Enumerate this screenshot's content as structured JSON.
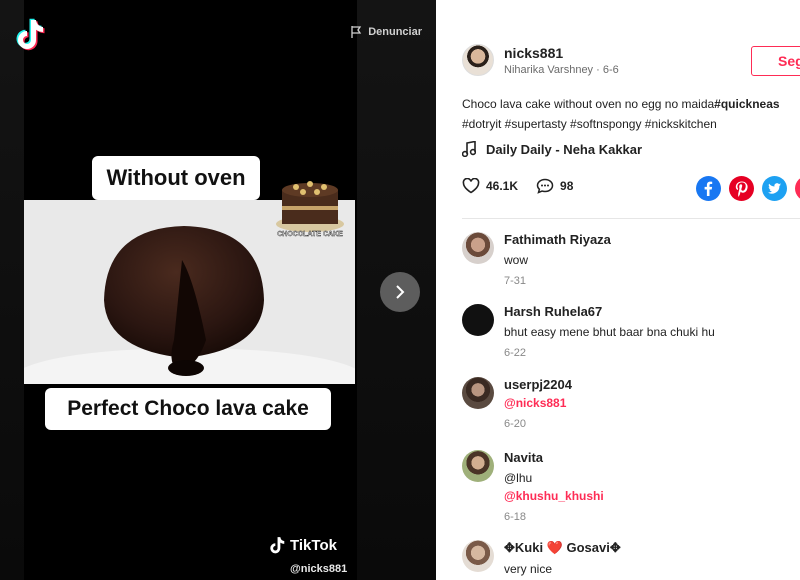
{
  "video": {
    "report_label": "Denunciar",
    "caption_top": "Without oven",
    "caption_bottom": "Perfect Choco lava cake",
    "sticker_text": "CHOCOLATE CAKE",
    "watermark_brand": "TikTok",
    "watermark_handle": "@nicks881"
  },
  "post": {
    "username": "nicks881",
    "display_name": "Niharika Varshney",
    "date": "6-6",
    "follow_label": "Seg",
    "description_plain": "Choco lava cake without oven no egg no maida",
    "description_tag_bold": "#quickneas",
    "description_line2": "#dotryit #supertasty #softnspongy #nickskitchen",
    "music": "Daily Daily - Neha Kakkar",
    "likes": "46.1K",
    "comments_count": "98"
  },
  "colors": {
    "accent": "#fe2c55",
    "facebook": "#1877f2",
    "pinterest": "#e60023",
    "twitter": "#1da1f2"
  },
  "comments": [
    {
      "name": "Fathimath Riyaza",
      "text": "wow",
      "mention": "",
      "date": "7-31"
    },
    {
      "name": "Harsh Ruhela67",
      "text": "bhut easy mene bhut baar bna chuki hu",
      "mention": "",
      "date": "6-22"
    },
    {
      "name": "userpj2204",
      "text": "",
      "mention": "@nicks881",
      "date": "6-20"
    },
    {
      "name": "Navita",
      "text": "@lhu",
      "mention": "@khushu_khushi",
      "date": "6-18"
    },
    {
      "name": "✥Kuki ❤️ Gosavi✥",
      "text": "very nice",
      "mention": "",
      "date": ""
    }
  ]
}
